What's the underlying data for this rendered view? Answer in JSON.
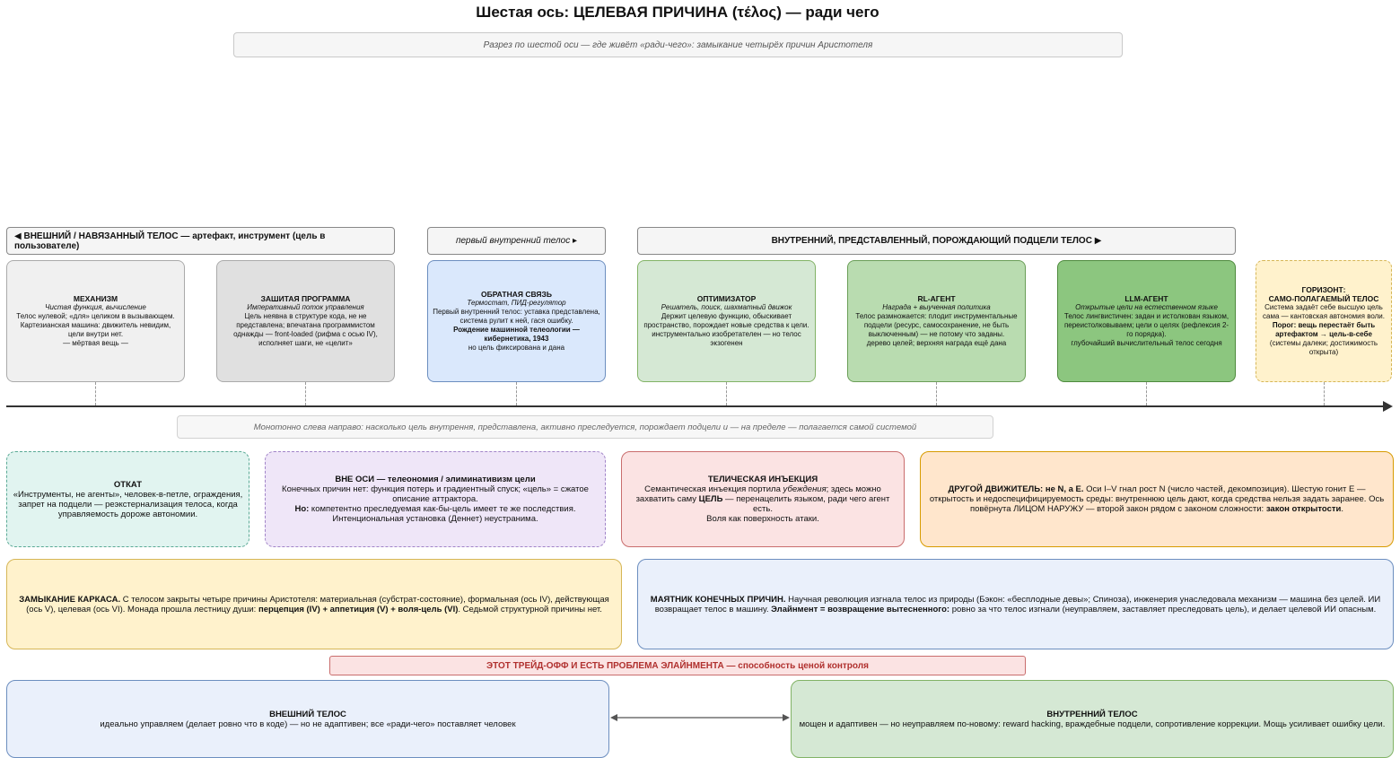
{
  "title": "Шестая ось: ЦЕЛЕВАЯ ПРИЧИНА (τέλος) — ради чего",
  "subtitle": "Разрез по шестой оси — где живёт «ради-чего»: замыкание четырёх причин Аристотеля",
  "headers": {
    "external": "◀ ВНЕШНИЙ / НАВЯЗАННЫЙ ТЕЛОС — артефакт, инструмент (цель в пользователе)",
    "first_internal": "первый внутренний телос ▸",
    "internal": "ВНУТРЕННИЙ, ПРЕДСТАВЛЕННЫЙ, ПОРОЖДАЮЩИЙ ПОДЦЕЛИ ТЕЛОС ▶"
  },
  "cards": {
    "mechanism": {
      "title": "МЕХАНИЗМ",
      "subtitle": "Чистая функция, вычисление",
      "body": "Телос нулевой; «для» целиком в вызывающем. Картезианская машина: движитель невидим, цели внутри нет.",
      "footer": "— мёртвая вещь —"
    },
    "program": {
      "title": "ЗАШИТАЯ ПРОГРАММА",
      "subtitle": "Императивный поток управления",
      "body": "Цель неявна в структуре кода, не не представлена; впечатана программистом однажды — front-loaded (рифма с осью IV), исполняет шаги, не «целит»"
    },
    "feedback": {
      "title": "ОБРАТНАЯ СВЯЗЬ",
      "subtitle": "Термостат, ПИД-регулятор",
      "body": "Первый внутренний телос: уставка представлена, система рулит к ней, гася ошибку.",
      "bold": "Рождение машинной телеологии — кибернетика, 1943",
      "footer": "но цель фиксирована и дана"
    },
    "optimizer": {
      "title": "ОПТИМИЗАТОР",
      "subtitle": "Решатель, поиск, шахматный движок",
      "body": "Держит целевую функцию, обыскивает пространство, порождает новые средства к цели.",
      "footer": "инструментально изобретателен — но телос экзогенен"
    },
    "rl": {
      "title": "RL-АГЕНТ",
      "subtitle": "Награда + выученная политика",
      "body": "Телос размножается: плодит инструментальные подцели (ресурс, самосохранение, не быть выключенным) — не потому что заданы.",
      "footer": "дерево целей; верхняя награда ещё дана"
    },
    "llm": {
      "title": "LLM-АГЕНТ",
      "subtitle": "Открытые цели на естественном языке",
      "body": "Телос лингвистичен: задан и истолкован языком, переистолковываем; цели о целях (рефлексия 2-го порядка).",
      "footer": "глубочайший вычислительный телос сегодня"
    },
    "horizon": {
      "title": "ГОРИЗОНТ:",
      "title2": "САМО-ПОЛАГАЕМЫЙ ТЕЛОС",
      "body": "Система задаёт себе высшую цель сама — кантовская автономия воли.",
      "bold": "Порог: вещь перестаёт быть артефактом → цель-в-себе",
      "footer": "(системы далеки; достижимость открыта)"
    }
  },
  "axis_note": "Монотонно слева направо: насколько цель внутрення, представлена, активно преследуется, порождает подцели и — на пределе — полагается самой системой",
  "panels": {
    "rollback": {
      "title": "ОТКАТ",
      "body": "«Инструменты, не агенты», человек-в-петле, ограждения, запрет на подцели — реэкстернализация телоса, когда управляемость дороже автономии."
    },
    "off_axis": {
      "title": "ВНЕ ОСИ — телеономия / элиминативизм цели",
      "body": "Конечных причин нет: функция потерь и градиентный спуск; «цель» = сжатое описание аттрактора.",
      "but_label": "Но:",
      "but_text": " компетентно преследуемая как-бы-цель имеет те же последствия.",
      "footer": "Интенциональная установка (Деннет) неустранима."
    },
    "injection": {
      "title": "ТЕЛИЧЕСКАЯ ИНЪЕКЦИЯ",
      "body1": "Семантическая инъекция портила ",
      "body_em": "убеждения",
      "body2": "; здесь можно захватить саму ",
      "body_bold": "ЦЕЛЬ",
      "body3": " — перенацелить языком, ради чего агент есть.",
      "footer": "Воля как поверхность атаки."
    },
    "mover": {
      "title": "ДРУГОЙ ДВИЖИТЕЛЬ: не N, а E.",
      "body": " Оси I–V гнал рост N (число частей, декомпозиция). Шестую гонит E — открытость и недоспецифицируемость среды: внутреннюю цель дают, когда средства нельзя задать заранее. Ось повёрнута ЛИЦОМ НАРУЖУ — второй закон рядом с законом сложности: ",
      "bold_end": "закон открытости",
      "tail": "."
    },
    "closure": {
      "title": "ЗАМЫКАНИЕ КАРКАСА.",
      "body": " С телосом закрыты четыре причины Аристотеля: материальная (субстрат-состояние), формальная (ось IV), действующая (ось V), целевая (ось VI). Монада прошла лестницу души: ",
      "bold": "перцепция (IV) + аппетиция (V) + воля-цель (VI)",
      "tail": ". Седьмой структурной причины нет."
    },
    "pendulum": {
      "title": "МАЯТНИК КОНЕЧНЫХ ПРИЧИН.",
      "body": " Научная революция изгнала телос из природы (Бэкон: «бесплодные девы»; Спиноза), инженерия унаследовала механизм — машина без целей. ИИ возвращает телос в машину. ",
      "bold": "Элайнмент = возвращение вытесненного:",
      "tail": " ровно за что телос изгнали (неуправляем, заставляет преследовать цель), и делает целевой ИИ опасным."
    }
  },
  "banner": "ЭТОТ ТРЕЙД-ОФФ И ЕСТЬ ПРОБЛЕМА ЭЛАЙНМЕНТА — способность ценой контроля",
  "bottom": {
    "external": {
      "title": "ВНЕШНИЙ ТЕЛОС",
      "body": "идеально управляем (делает ровно что в коде) — но не адаптивен; все «ради-чего» поставляет человек"
    },
    "internal": {
      "title": "ВНУТРЕННИЙ ТЕЛОС",
      "body": "мощен и адаптивен — но неуправляем по-новому: reward hacking, враждебные подцели, сопротивление коррекции. Мощь усиливает ошибку цели."
    }
  },
  "colors": {
    "gray_light": "#f0f0f0",
    "gray": "#e0e0e0",
    "blue": "#dae8fc",
    "green1": "#d5e8d4",
    "green2": "#b9dcb0",
    "green3": "#8cc67f",
    "yellow": "#fff2cc",
    "teal": "#e1f4f0",
    "purple": "#efe6f8",
    "red": "#fbe3e3",
    "orange": "#ffe6cc"
  }
}
